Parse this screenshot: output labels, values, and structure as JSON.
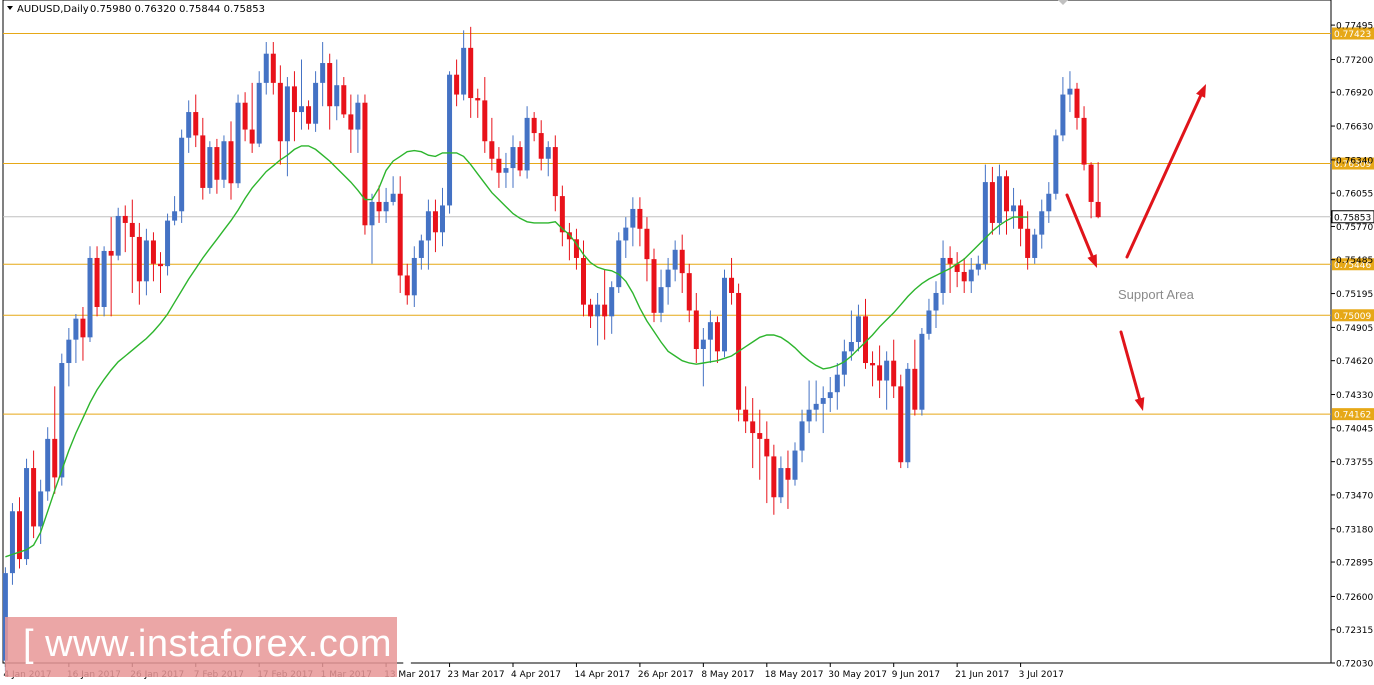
{
  "header": {
    "symbol": "AUDUSD,Daily",
    "ohlc": "0.75980 0.76320 0.75844 0.75853"
  },
  "watermark": {
    "text": "[ www.instaforex.com ]"
  },
  "colors": {
    "bull": "#4472c4",
    "bear": "#e8121a",
    "ma": "#2db52d",
    "level": "#e6a817",
    "arrow": "#e0141a",
    "current": "#c0c0c0"
  },
  "chart_data": {
    "type": "candlestick",
    "ylim": [
      0.7203,
      0.7771
    ],
    "y_ticks": [
      "0.77495",
      "0.77200",
      "0.76920",
      "0.76630",
      "0.76340",
      "0.76055",
      "0.75770",
      "0.75485",
      "0.75195",
      "0.74905",
      "0.74620",
      "0.74330",
      "0.74045",
      "0.73755",
      "0.73470",
      "0.73180",
      "0.72895",
      "0.72600",
      "0.72315",
      "0.72030"
    ],
    "x_labels": [
      "4 Jan 2017",
      "16 Jan 2017",
      "26 Jan 2017",
      "7 Feb 2017",
      "17 Feb 2017",
      "1 Mar 2017",
      "13 Mar 2017",
      "23 Mar 2017",
      "4 Apr 2017",
      "14 Apr 2017",
      "26 Apr 2017",
      "8 May 2017",
      "18 May 2017",
      "30 May 2017",
      "9 Jun 2017",
      "21 Jun 2017",
      "3 Jul 2017"
    ],
    "x_label_index": [
      0,
      9,
      18,
      27,
      36,
      45,
      54,
      63,
      72,
      81,
      90,
      99,
      108,
      117,
      126,
      135,
      144
    ],
    "levels": [
      {
        "label": "0.77423",
        "value": 0.77423
      },
      {
        "label": "0.76309",
        "value": 0.76309
      },
      {
        "label": "0.75446",
        "value": 0.75446
      },
      {
        "label": "0.75009",
        "value": 0.75009
      },
      {
        "label": "0.74162",
        "value": 0.74162
      }
    ],
    "current": {
      "label": "0.75853",
      "value": 0.75853
    },
    "annotation": "Support Area",
    "candles": [
      [
        0.7205,
        0.7285,
        0.7196,
        0.728
      ],
      [
        0.728,
        0.734,
        0.727,
        0.7333
      ],
      [
        0.7333,
        0.7345,
        0.7284,
        0.7292
      ],
      [
        0.7292,
        0.7378,
        0.7287,
        0.737
      ],
      [
        0.737,
        0.7385,
        0.731,
        0.732
      ],
      [
        0.732,
        0.736,
        0.7305,
        0.735
      ],
      [
        0.735,
        0.7405,
        0.7342,
        0.7395
      ],
      [
        0.7395,
        0.744,
        0.7348,
        0.7362
      ],
      [
        0.7362,
        0.7468,
        0.7355,
        0.746
      ],
      [
        0.746,
        0.749,
        0.744,
        0.748
      ],
      [
        0.748,
        0.7502,
        0.746,
        0.7498
      ],
      [
        0.7498,
        0.7508,
        0.7462,
        0.7482
      ],
      [
        0.7482,
        0.756,
        0.7478,
        0.755
      ],
      [
        0.755,
        0.756,
        0.75,
        0.7508
      ],
      [
        0.7508,
        0.756,
        0.75,
        0.7556
      ],
      [
        0.7556,
        0.7585,
        0.75,
        0.7552
      ],
      [
        0.7552,
        0.7593,
        0.7548,
        0.7586
      ],
      [
        0.7586,
        0.7595,
        0.7555,
        0.758
      ],
      [
        0.758,
        0.76,
        0.752,
        0.7568
      ],
      [
        0.7568,
        0.758,
        0.751,
        0.753
      ],
      [
        0.753,
        0.7575,
        0.7518,
        0.7565
      ],
      [
        0.7565,
        0.7572,
        0.753,
        0.7545
      ],
      [
        0.7545,
        0.7555,
        0.752,
        0.7543
      ],
      [
        0.7543,
        0.7588,
        0.7535,
        0.7582
      ],
      [
        0.7582,
        0.7603,
        0.7578,
        0.759
      ],
      [
        0.759,
        0.766,
        0.758,
        0.7653
      ],
      [
        0.7653,
        0.7685,
        0.764,
        0.7675
      ],
      [
        0.7675,
        0.769,
        0.7645,
        0.7655
      ],
      [
        0.7655,
        0.767,
        0.76,
        0.761
      ],
      [
        0.761,
        0.765,
        0.7605,
        0.7645
      ],
      [
        0.7645,
        0.7652,
        0.7605,
        0.7617
      ],
      [
        0.7617,
        0.7655,
        0.761,
        0.765
      ],
      [
        0.765,
        0.7667,
        0.76,
        0.7614
      ],
      [
        0.7614,
        0.769,
        0.761,
        0.7683
      ],
      [
        0.7683,
        0.7692,
        0.765,
        0.766
      ],
      [
        0.766,
        0.77,
        0.764,
        0.7648
      ],
      [
        0.7648,
        0.771,
        0.7645,
        0.77
      ],
      [
        0.77,
        0.7735,
        0.769,
        0.7725
      ],
      [
        0.7725,
        0.7735,
        0.769,
        0.77
      ],
      [
        0.77,
        0.7715,
        0.763,
        0.765
      ],
      [
        0.765,
        0.7705,
        0.762,
        0.7697
      ],
      [
        0.7697,
        0.771,
        0.765,
        0.7675
      ],
      [
        0.7675,
        0.772,
        0.766,
        0.768
      ],
      [
        0.768,
        0.7685,
        0.766,
        0.7665
      ],
      [
        0.7665,
        0.771,
        0.7658,
        0.77
      ],
      [
        0.77,
        0.7735,
        0.768,
        0.7717
      ],
      [
        0.7717,
        0.7725,
        0.766,
        0.768
      ],
      [
        0.768,
        0.772,
        0.7668,
        0.7698
      ],
      [
        0.7698,
        0.7705,
        0.767,
        0.7673
      ],
      [
        0.7673,
        0.769,
        0.764,
        0.766
      ],
      [
        0.766,
        0.769,
        0.764,
        0.7683
      ],
      [
        0.7683,
        0.769,
        0.757,
        0.7578
      ],
      [
        0.7578,
        0.7605,
        0.7545,
        0.7598
      ],
      [
        0.7598,
        0.7612,
        0.758,
        0.759
      ],
      [
        0.759,
        0.761,
        0.758,
        0.7598
      ],
      [
        0.7598,
        0.762,
        0.7595,
        0.7605
      ],
      [
        0.7605,
        0.762,
        0.752,
        0.7535
      ],
      [
        0.7535,
        0.7545,
        0.751,
        0.7518
      ],
      [
        0.7518,
        0.756,
        0.7508,
        0.755
      ],
      [
        0.755,
        0.757,
        0.754,
        0.7565
      ],
      [
        0.7565,
        0.76,
        0.754,
        0.759
      ],
      [
        0.759,
        0.76,
        0.7555,
        0.7572
      ],
      [
        0.7572,
        0.761,
        0.756,
        0.7595
      ],
      [
        0.7595,
        0.771,
        0.7588,
        0.7707
      ],
      [
        0.7707,
        0.772,
        0.768,
        0.769
      ],
      [
        0.769,
        0.7745,
        0.7685,
        0.773
      ],
      [
        0.773,
        0.7748,
        0.767,
        0.7687
      ],
      [
        0.7687,
        0.7695,
        0.767,
        0.7685
      ],
      [
        0.7685,
        0.7705,
        0.764,
        0.765
      ],
      [
        0.765,
        0.767,
        0.7625,
        0.7635
      ],
      [
        0.7635,
        0.7645,
        0.761,
        0.7623
      ],
      [
        0.7623,
        0.764,
        0.761,
        0.7627
      ],
      [
        0.7627,
        0.7655,
        0.761,
        0.7645
      ],
      [
        0.7645,
        0.765,
        0.762,
        0.7625
      ],
      [
        0.7625,
        0.768,
        0.7618,
        0.767
      ],
      [
        0.767,
        0.7675,
        0.765,
        0.7657
      ],
      [
        0.7657,
        0.7668,
        0.7625,
        0.7635
      ],
      [
        0.7635,
        0.765,
        0.762,
        0.7645
      ],
      [
        0.7645,
        0.7655,
        0.759,
        0.7603
      ],
      [
        0.7603,
        0.7612,
        0.756,
        0.7572
      ],
      [
        0.7572,
        0.758,
        0.7548,
        0.7566
      ],
      [
        0.7566,
        0.7575,
        0.754,
        0.755
      ],
      [
        0.755,
        0.7565,
        0.75,
        0.751
      ],
      [
        0.751,
        0.7515,
        0.749,
        0.75
      ],
      [
        0.75,
        0.752,
        0.7475,
        0.751
      ],
      [
        0.751,
        0.754,
        0.748,
        0.75
      ],
      [
        0.75,
        0.753,
        0.7485,
        0.7525
      ],
      [
        0.7525,
        0.7572,
        0.752,
        0.7565
      ],
      [
        0.7565,
        0.7585,
        0.755,
        0.7576
      ],
      [
        0.7576,
        0.7602,
        0.756,
        0.7592
      ],
      [
        0.7592,
        0.7602,
        0.756,
        0.7575
      ],
      [
        0.7575,
        0.7585,
        0.753,
        0.7549
      ],
      [
        0.7549,
        0.7558,
        0.7495,
        0.7503
      ],
      [
        0.7503,
        0.754,
        0.7495,
        0.7525
      ],
      [
        0.7525,
        0.755,
        0.751,
        0.754
      ],
      [
        0.754,
        0.7565,
        0.753,
        0.7557
      ],
      [
        0.7557,
        0.757,
        0.752,
        0.7537
      ],
      [
        0.7537,
        0.7545,
        0.7495,
        0.7505
      ],
      [
        0.7505,
        0.752,
        0.746,
        0.7472
      ],
      [
        0.7472,
        0.749,
        0.744,
        0.748
      ],
      [
        0.748,
        0.7505,
        0.746,
        0.7495
      ],
      [
        0.7495,
        0.75,
        0.746,
        0.747
      ],
      [
        0.747,
        0.754,
        0.7465,
        0.7533
      ],
      [
        0.7533,
        0.755,
        0.751,
        0.752
      ],
      [
        0.752,
        0.7528,
        0.741,
        0.742
      ],
      [
        0.742,
        0.744,
        0.74,
        0.741
      ],
      [
        0.741,
        0.743,
        0.737,
        0.74
      ],
      [
        0.74,
        0.742,
        0.736,
        0.7395
      ],
      [
        0.7395,
        0.741,
        0.734,
        0.738
      ],
      [
        0.738,
        0.739,
        0.733,
        0.7345
      ],
      [
        0.7345,
        0.738,
        0.734,
        0.737
      ],
      [
        0.737,
        0.7385,
        0.7335,
        0.736
      ],
      [
        0.736,
        0.7392,
        0.7355,
        0.7385
      ],
      [
        0.7385,
        0.742,
        0.7375,
        0.741
      ],
      [
        0.741,
        0.7445,
        0.74,
        0.742
      ],
      [
        0.742,
        0.7445,
        0.741,
        0.7425
      ],
      [
        0.7425,
        0.744,
        0.74,
        0.743
      ],
      [
        0.743,
        0.7448,
        0.7418,
        0.7435
      ],
      [
        0.7435,
        0.746,
        0.742,
        0.745
      ],
      [
        0.745,
        0.748,
        0.744,
        0.747
      ],
      [
        0.747,
        0.7505,
        0.7462,
        0.7478
      ],
      [
        0.7478,
        0.751,
        0.747,
        0.75
      ],
      [
        0.75,
        0.7515,
        0.7455,
        0.746
      ],
      [
        0.746,
        0.747,
        0.744,
        0.7458
      ],
      [
        0.7458,
        0.7475,
        0.743,
        0.7445
      ],
      [
        0.7445,
        0.747,
        0.742,
        0.7462
      ],
      [
        0.7462,
        0.748,
        0.743,
        0.744
      ],
      [
        0.744,
        0.745,
        0.737,
        0.7375
      ],
      [
        0.7375,
        0.746,
        0.737,
        0.7455
      ],
      [
        0.7455,
        0.748,
        0.7415,
        0.742
      ],
      [
        0.742,
        0.749,
        0.7415,
        0.7485
      ],
      [
        0.7485,
        0.7515,
        0.748,
        0.7505
      ],
      [
        0.7505,
        0.753,
        0.749,
        0.752
      ],
      [
        0.752,
        0.7565,
        0.751,
        0.755
      ],
      [
        0.755,
        0.756,
        0.752,
        0.7545
      ],
      [
        0.7545,
        0.7555,
        0.7525,
        0.7538
      ],
      [
        0.7538,
        0.755,
        0.752,
        0.753
      ],
      [
        0.753,
        0.755,
        0.752,
        0.754
      ],
      [
        0.754,
        0.7552,
        0.7535,
        0.7545
      ],
      [
        0.7545,
        0.763,
        0.754,
        0.7615
      ],
      [
        0.7615,
        0.7628,
        0.757,
        0.758
      ],
      [
        0.758,
        0.763,
        0.757,
        0.762
      ],
      [
        0.762,
        0.7625,
        0.757,
        0.759
      ],
      [
        0.759,
        0.761,
        0.7575,
        0.7595
      ],
      [
        0.7595,
        0.76,
        0.756,
        0.7575
      ],
      [
        0.7575,
        0.759,
        0.754,
        0.755
      ],
      [
        0.755,
        0.7575,
        0.7545,
        0.757
      ],
      [
        0.757,
        0.76,
        0.7558,
        0.759
      ],
      [
        0.759,
        0.7615,
        0.758,
        0.7605
      ],
      [
        0.7605,
        0.766,
        0.76,
        0.7655
      ],
      [
        0.7655,
        0.7705,
        0.765,
        0.769
      ],
      [
        0.769,
        0.771,
        0.7675,
        0.7695
      ],
      [
        0.7695,
        0.77,
        0.766,
        0.767
      ],
      [
        0.767,
        0.768,
        0.7625,
        0.763
      ],
      [
        0.763,
        0.7632,
        0.7584,
        0.7598
      ],
      [
        0.7598,
        0.7632,
        0.7584,
        0.7585
      ]
    ],
    "ma": [
      0.7294,
      0.7296,
      0.7298,
      0.73,
      0.7304,
      0.7315,
      0.7333,
      0.7351,
      0.7368,
      0.7385,
      0.74,
      0.7413,
      0.7426,
      0.7437,
      0.7446,
      0.7454,
      0.7461,
      0.7466,
      0.7471,
      0.7476,
      0.7481,
      0.7487,
      0.7494,
      0.7502,
      0.7512,
      0.7522,
      0.7532,
      0.7541,
      0.755,
      0.7558,
      0.7566,
      0.7574,
      0.7582,
      0.7591,
      0.7601,
      0.761,
      0.7617,
      0.7624,
      0.7629,
      0.7634,
      0.7638,
      0.7643,
      0.7646,
      0.7646,
      0.7643,
      0.7638,
      0.7633,
      0.7627,
      0.7621,
      0.7615,
      0.7608,
      0.76,
      0.76,
      0.761,
      0.7625,
      0.7633,
      0.7637,
      0.7641,
      0.7642,
      0.7641,
      0.7638,
      0.7637,
      0.764,
      0.764,
      0.764,
      0.7637,
      0.763,
      0.7622,
      0.7614,
      0.7606,
      0.76,
      0.7594,
      0.7588,
      0.7584,
      0.7581,
      0.758,
      0.758,
      0.758,
      0.7581,
      0.7575,
      0.757,
      0.7562,
      0.7553,
      0.7546,
      0.7542,
      0.754,
      0.7539,
      0.7536,
      0.753,
      0.752,
      0.7507,
      0.7496,
      0.7487,
      0.7478,
      0.747,
      0.7466,
      0.7462,
      0.746,
      0.7459,
      0.746,
      0.7461,
      0.7462,
      0.7464,
      0.7466,
      0.747,
      0.7474,
      0.7478,
      0.7482,
      0.7484,
      0.7484,
      0.7482,
      0.7478,
      0.7473,
      0.7467,
      0.7462,
      0.7458,
      0.7455,
      0.7456,
      0.7458,
      0.7461,
      0.7466,
      0.7472,
      0.7478,
      0.7484,
      0.7491,
      0.7497,
      0.7503,
      0.751,
      0.7517,
      0.7523,
      0.7528,
      0.7532,
      0.7535,
      0.7538,
      0.7541,
      0.7545,
      0.7549,
      0.7555,
      0.7561,
      0.7567,
      0.7573,
      0.7578,
      0.7582,
      0.7585,
      0.7585,
      0.7585
    ]
  }
}
